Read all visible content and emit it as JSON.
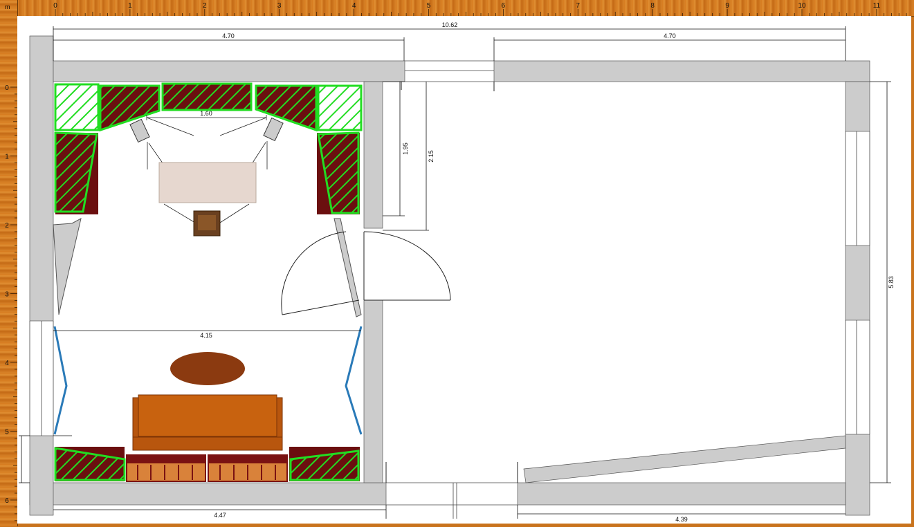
{
  "ruler": {
    "unit_label": "m",
    "top_ticks": [
      "0",
      "1",
      "2",
      "3",
      "4",
      "5",
      "6",
      "7",
      "8",
      "9",
      "10",
      "11"
    ],
    "left_ticks": [
      "0",
      "1",
      "2",
      "3",
      "4",
      "5",
      "6"
    ]
  },
  "dimensions": {
    "total_width": "10.62",
    "left_top_width": "4.70",
    "right_top_width": "4.70",
    "desk_speaker_spacing": "1.60",
    "inner_height_a": "1.95",
    "inner_height_b": "2.15",
    "room_width": "4.15",
    "right_height": "5.83",
    "bottom_left_width": "4.47",
    "bottom_right_width": "4.39"
  },
  "colors": {
    "wall": "#cccccc",
    "absorber_green": "#22dd22",
    "absorber_dark": "#6b0f0f",
    "sofa": "#b8560e",
    "rug": "#8b3a10",
    "curtain_blue": "#2a7ab8"
  }
}
